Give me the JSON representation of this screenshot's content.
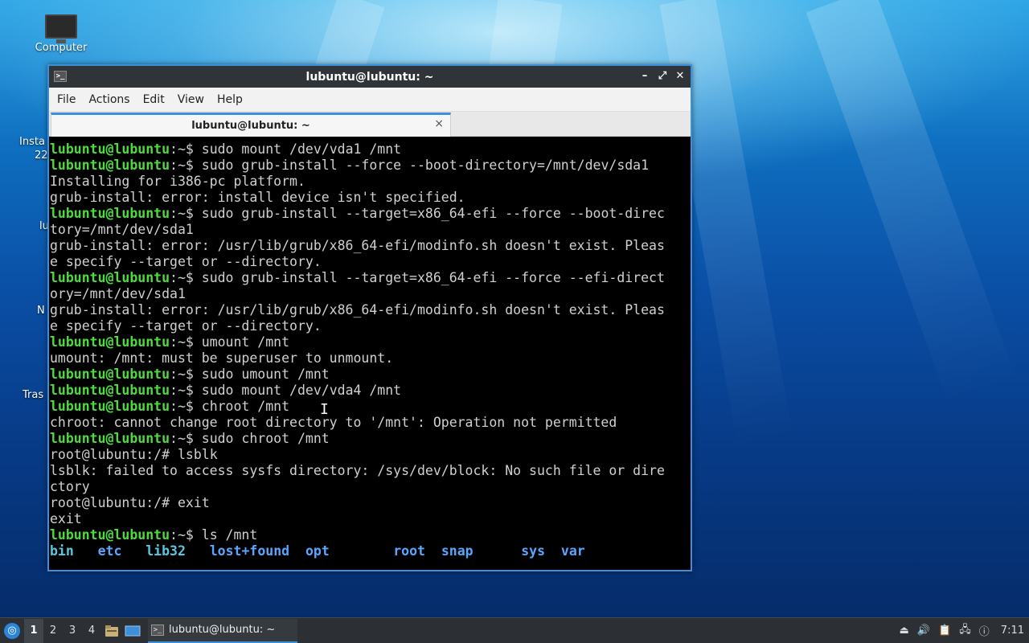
{
  "desktop": {
    "icons": [
      {
        "label": "Computer",
        "icon": "computer-icon"
      }
    ],
    "partial_labels": [
      "Insta",
      "22",
      "lu",
      "N",
      "Tras"
    ]
  },
  "window": {
    "title": "lubuntu@lubuntu: ~",
    "controls": {
      "minimize": "–",
      "maximize": "⤢",
      "close": "✕"
    },
    "menu": [
      "File",
      "Actions",
      "Edit",
      "View",
      "Help"
    ],
    "tab": {
      "label": "lubuntu@lubuntu: ~",
      "close": "×"
    }
  },
  "terminal": {
    "prompt_user": "lubuntu@lubuntu",
    "prompt_path": ":~",
    "root_prompt": "root@lubuntu:/# ",
    "lines": [
      {
        "kind": "prompt",
        "text": "$ sudo mount /dev/vda1 /mnt"
      },
      {
        "kind": "prompt",
        "text": "$ sudo grub-install --force --boot-directory=/mnt/dev/sda1"
      },
      {
        "kind": "output",
        "text": "Installing for i386-pc platform."
      },
      {
        "kind": "output",
        "text": "grub-install: error: install device isn't specified."
      },
      {
        "kind": "prompt",
        "text": "$ sudo grub-install --target=x86_64-efi --force --boot-direc"
      },
      {
        "kind": "output",
        "text": "tory=/mnt/dev/sda1"
      },
      {
        "kind": "output",
        "text": "grub-install: error: /usr/lib/grub/x86_64-efi/modinfo.sh doesn't exist. Pleas"
      },
      {
        "kind": "output",
        "text": "e specify --target or --directory."
      },
      {
        "kind": "prompt",
        "text": "$ sudo grub-install --target=x86_64-efi --force --efi-direct"
      },
      {
        "kind": "output",
        "text": "ory=/mnt/dev/sda1"
      },
      {
        "kind": "output",
        "text": "grub-install: error: /usr/lib/grub/x86_64-efi/modinfo.sh doesn't exist. Pleas"
      },
      {
        "kind": "output",
        "text": "e specify --target or --directory."
      },
      {
        "kind": "prompt",
        "text": "$ umount /mnt"
      },
      {
        "kind": "output",
        "text": "umount: /mnt: must be superuser to unmount."
      },
      {
        "kind": "prompt",
        "text": "$ sudo umount /mnt"
      },
      {
        "kind": "prompt",
        "text": "$ sudo mount /dev/vda4 /mnt"
      },
      {
        "kind": "prompt",
        "text": "$ chroot /mnt"
      },
      {
        "kind": "output",
        "text": "chroot: cannot change root directory to '/mnt': Operation not permitted"
      },
      {
        "kind": "prompt",
        "text": "$ sudo chroot /mnt"
      },
      {
        "kind": "root",
        "text": "lsblk"
      },
      {
        "kind": "output",
        "text": "lsblk: failed to access sysfs directory: /sys/dev/block: No such file or dire"
      },
      {
        "kind": "output",
        "text": "ctory"
      },
      {
        "kind": "root",
        "text": "exit"
      },
      {
        "kind": "output",
        "text": "exit"
      },
      {
        "kind": "prompt",
        "text": "$ ls /mnt"
      },
      {
        "kind": "ls",
        "items": [
          {
            "name": "bin",
            "style": "cyan"
          },
          {
            "name": "etc",
            "style": "b"
          },
          {
            "name": "lib32",
            "style": "cyan"
          },
          {
            "name": "lost+found",
            "style": "b"
          },
          {
            "name": "opt",
            "style": "b"
          },
          {
            "name": "root",
            "style": "b"
          },
          {
            "name": "snap",
            "style": "b"
          },
          {
            "name": "sys",
            "style": "b"
          },
          {
            "name": "var",
            "style": "b"
          }
        ]
      }
    ]
  },
  "taskbar": {
    "desktops": [
      "1",
      "2",
      "3",
      "4"
    ],
    "active_desktop": "1",
    "task_label": "lubuntu@lubuntu: ~",
    "clock": "7:11"
  }
}
